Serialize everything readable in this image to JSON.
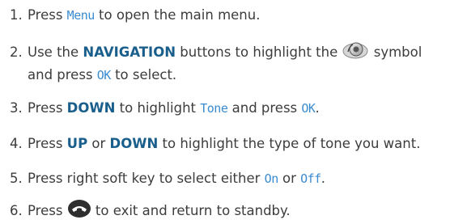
{
  "colors": {
    "text": "#3c3c3c",
    "keyword": "#1a5f8c",
    "display_text": "#3a8bd0"
  },
  "steps": [
    {
      "num": "1.",
      "a": "Press ",
      "menu": "Menu",
      "b": " to open the main menu."
    },
    {
      "num": "2.",
      "a": "Use the ",
      "kw": "NAVIGATION",
      "b": " buttons to highlight the ",
      "icon": "speaker-volume-icon",
      "c": " symbol",
      "d": "and press ",
      "ok": "OK",
      "e": " to select."
    },
    {
      "num": "3.",
      "a": "Press ",
      "kw": "DOWN",
      "b": " to highlight ",
      "tone": "Tone",
      "c": " and press ",
      "ok": "OK",
      "d": "."
    },
    {
      "num": "4.",
      "a": "Press ",
      "kw1": "UP",
      "b": " or ",
      "kw2": "DOWN",
      "c": " to highlight the type of tone you want."
    },
    {
      "num": "5.",
      "a": "Press right soft key to select either ",
      "on": "On",
      "b": " or ",
      "off": "Off",
      "c": "."
    },
    {
      "num": "6.",
      "a": "Press ",
      "icon": "end-call-key-icon",
      "b": " to exit and return to standby."
    }
  ]
}
